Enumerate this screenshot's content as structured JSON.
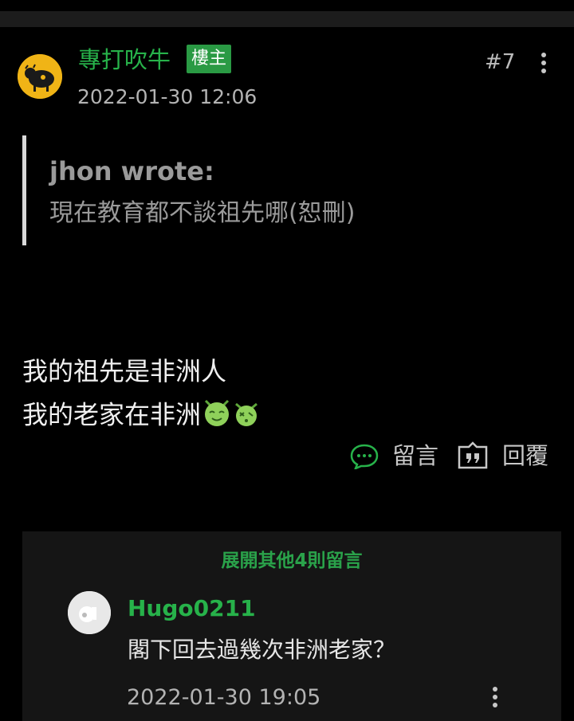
{
  "post": {
    "author": "專打吹牛",
    "badge": "樓主",
    "time": "2022-01-30 12:06",
    "floor": "#7",
    "avatar_icon": "cow-avatar",
    "quote": {
      "author": "jhon wrote:",
      "text": "現在教育都不談祖先哪(恕刪)"
    },
    "lines": [
      "我的祖先是非洲人",
      "我的老家在非洲"
    ],
    "emojis": [
      "smiling-green-face-emoji",
      "dizzy-green-face-emoji"
    ]
  },
  "actions": {
    "comment_label": "留言",
    "reply_label": "回覆"
  },
  "comments": {
    "expand_label": "展開其他4則留言",
    "items": [
      {
        "author": "Hugo0211",
        "text": "閣下回去過幾次非洲老家？",
        "time": "2022-01-30 19:05",
        "avatar_icon": "default-avatar"
      }
    ]
  },
  "colors": {
    "accent": "#27b24a",
    "background": "#000000",
    "comment_bg": "#151515"
  }
}
